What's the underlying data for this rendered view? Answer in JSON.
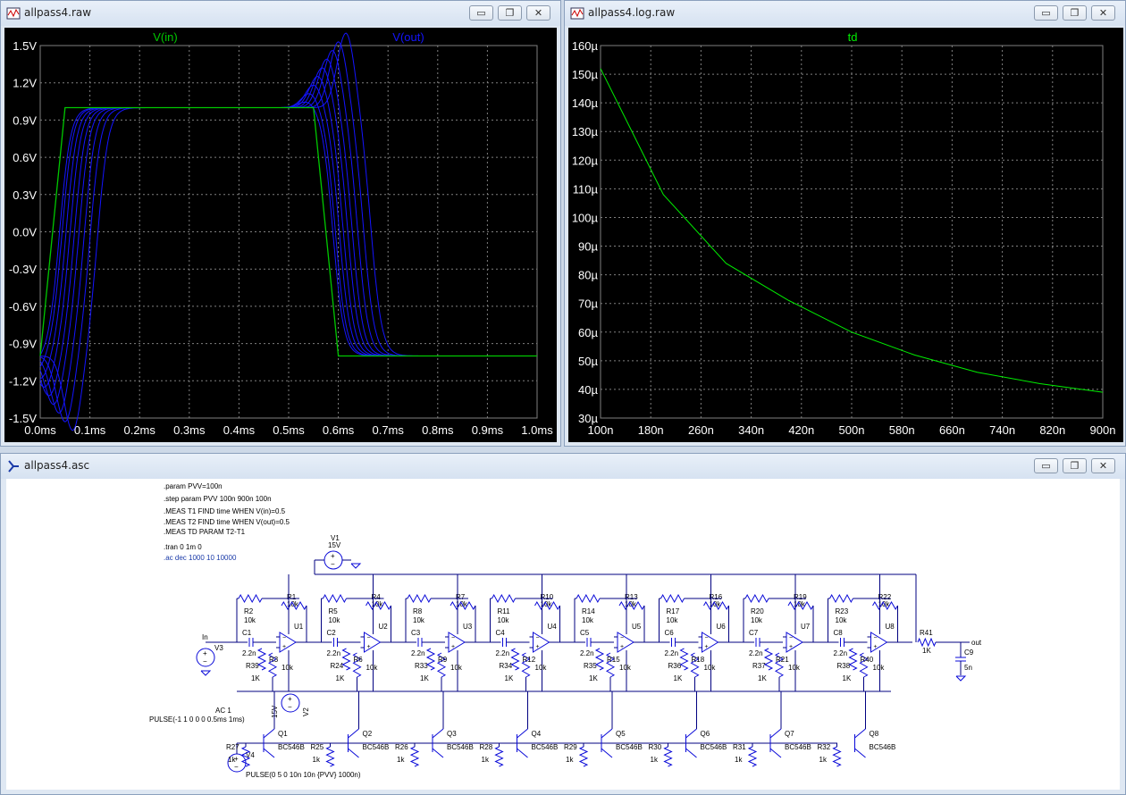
{
  "windows": {
    "left": {
      "title": "allpass4.raw"
    },
    "right": {
      "title": "allpass4.log.raw"
    },
    "bottom": {
      "title": "allpass4.asc"
    }
  },
  "window_buttons": {
    "minimize": "▭",
    "restore": "❐",
    "close": "✕"
  },
  "colors": {
    "vin": "#00c800",
    "vout": "#1414ff",
    "td": "#00ee00",
    "grid": "#808080",
    "axis_text": "#ffffff",
    "schematic": "#0a0ad8",
    "wire": "#000080"
  },
  "chart_data": [
    {
      "type": "line",
      "legend": [
        "V(in)",
        "V(out)"
      ],
      "x_ticks": [
        "0.0ms",
        "0.1ms",
        "0.2ms",
        "0.3ms",
        "0.4ms",
        "0.5ms",
        "0.6ms",
        "0.7ms",
        "0.8ms",
        "0.9ms",
        "1.0ms"
      ],
      "y_ticks": [
        "1.5V",
        "1.2V",
        "0.9V",
        "0.6V",
        "0.3V",
        "0.0V",
        "-0.3V",
        "-0.6V",
        "-0.9V",
        "-1.2V",
        "-1.5V"
      ],
      "xlim": [
        0,
        1.0
      ],
      "ylim": [
        -1.5,
        1.5
      ],
      "grid": true,
      "series": [
        {
          "name": "V(in)",
          "x": [
            0,
            0.05,
            0.55,
            0.6,
            1.0
          ],
          "y": [
            -1,
            1,
            1,
            -1,
            -1
          ]
        },
        {
          "name": "V(out)",
          "steps": [
            0.1,
            0.2,
            0.3,
            0.4,
            0.5,
            0.6,
            0.7,
            0.8,
            0.9
          ],
          "delays_ms": [
            0.039,
            0.044,
            0.052,
            0.06,
            0.069,
            0.078,
            0.089,
            0.101,
            0.116
          ]
        }
      ]
    },
    {
      "type": "line",
      "legend": [
        "td"
      ],
      "x_ticks": [
        "100n",
        "180n",
        "260n",
        "340n",
        "420n",
        "500n",
        "580n",
        "660n",
        "740n",
        "820n",
        "900n"
      ],
      "y_ticks": [
        "160µ",
        "150µ",
        "140µ",
        "130µ",
        "120µ",
        "110µ",
        "100µ",
        "90µ",
        "80µ",
        "70µ",
        "60µ",
        "50µ",
        "40µ",
        "30µ"
      ],
      "xlim": [
        100,
        900
      ],
      "ylim": [
        30,
        160
      ],
      "grid": true,
      "series": [
        {
          "name": "td",
          "x": [
            100,
            200,
            300,
            400,
            500,
            600,
            700,
            800,
            900
          ],
          "y": [
            152,
            108,
            84,
            71,
            60,
            52,
            46,
            42,
            39
          ]
        }
      ]
    }
  ],
  "schematic": {
    "directives": [
      ".param PVV=100n",
      ".step param PVV 100n 900n 100n",
      ".MEAS T1 FIND time WHEN V(in)=0.5",
      ".MEAS T2 FIND time WHEN V(out)=0.5",
      ".MEAS TD PARAM T2-T1",
      ".tran 0 1m 0"
    ],
    "ac_directive": ".ac dec 1000 10 10000",
    "stages": [
      {
        "rA": "R2",
        "rB": "R1",
        "c": "C1",
        "rGnd": "R39",
        "rBias": "R3",
        "u": "U1",
        "rE": "R27",
        "q": "Q1"
      },
      {
        "rA": "R5",
        "rB": "R4",
        "c": "C2",
        "rGnd": "R24",
        "rBias": "R6",
        "u": "U2",
        "rE": "R25",
        "q": "Q2"
      },
      {
        "rA": "R8",
        "rB": "R7",
        "c": "C3",
        "rGnd": "R33",
        "rBias": "R9",
        "u": "U3",
        "rE": "R26",
        "q": "Q3"
      },
      {
        "rA": "R11",
        "rB": "R10",
        "c": "C4",
        "rGnd": "R34",
        "rBias": "R12",
        "u": "U4",
        "rE": "R28",
        "q": "Q4"
      },
      {
        "rA": "R14",
        "rB": "R13",
        "c": "C5",
        "rGnd": "R35",
        "rBias": "R15",
        "u": "U5",
        "rE": "R29",
        "q": "Q5"
      },
      {
        "rA": "R17",
        "rB": "R16",
        "c": "C6",
        "rGnd": "R36",
        "rBias": "R18",
        "u": "U6",
        "rE": "R30",
        "q": "Q6"
      },
      {
        "rA": "R20",
        "rB": "R19",
        "c": "C7",
        "rGnd": "R37",
        "rBias": "R21",
        "u": "U7",
        "rE": "R31",
        "q": "Q7"
      },
      {
        "rA": "R23",
        "rB": "R22",
        "c": "C8",
        "rGnd": "R38",
        "rBias": "R40",
        "u": "U8",
        "rE": "R32",
        "q": "Q8"
      }
    ],
    "values": {
      "r10k": "10k",
      "r1k": "1K",
      "r1k_lower": "1k",
      "cap": "2.2n",
      "bjt": "BC546B"
    },
    "v1": {
      "name": "V1",
      "value": "15V"
    },
    "v2": {
      "name": "V2",
      "value": "15V"
    },
    "v3": {
      "name": "V3",
      "ac": "AC 1",
      "pulse": "PULSE(-1 1 0 0 0 0.5ms 1ms)"
    },
    "v4": {
      "name": "V4",
      "pulse": "PULSE(0 5 0 10n 10n {PVV} 1000n)"
    },
    "net_in": "In",
    "net_out": "out",
    "r41": {
      "name": "R41",
      "value": "1K"
    },
    "c9": {
      "name": "C9",
      "value": "5n"
    }
  }
}
